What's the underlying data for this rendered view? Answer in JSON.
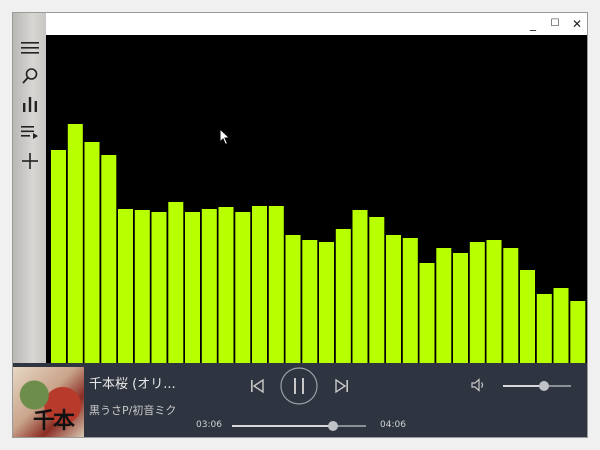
{
  "window": {
    "controls": {
      "minimize": "_",
      "maximize": "☐",
      "close": "✕"
    }
  },
  "sidebar": {
    "items": [
      {
        "name": "menu",
        "icon": "hamburger-icon"
      },
      {
        "name": "search",
        "icon": "search-icon"
      },
      {
        "name": "visualizer",
        "icon": "bar-chart-icon"
      },
      {
        "name": "playlist",
        "icon": "playlist-icon"
      },
      {
        "name": "add",
        "icon": "plus-icon"
      }
    ]
  },
  "visualizer": {
    "bar_color": "#b8ff00",
    "levels": [
      0.65,
      0.73,
      0.675,
      0.635,
      0.47,
      0.465,
      0.46,
      0.49,
      0.46,
      0.47,
      0.475,
      0.46,
      0.48,
      0.48,
      0.39,
      0.375,
      0.37,
      0.41,
      0.465,
      0.445,
      0.39,
      0.38,
      0.305,
      0.35,
      0.335,
      0.37,
      0.375,
      0.35,
      0.285,
      0.21,
      0.23,
      0.19
    ]
  },
  "player": {
    "title": "千本桜 (オリ...",
    "artist": "黒うさP/初音ミク",
    "album_art_text": "千本桜",
    "time_elapsed": "03:06",
    "time_total": "04:06",
    "progress": 0.756,
    "volume": 0.6,
    "state": "playing"
  }
}
